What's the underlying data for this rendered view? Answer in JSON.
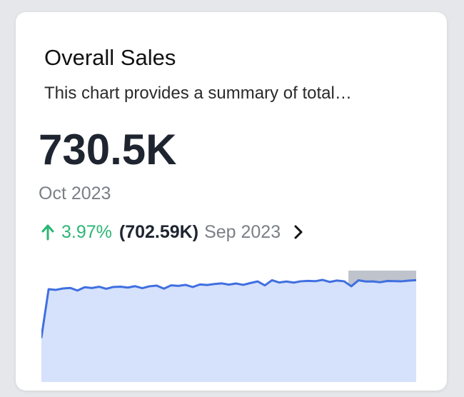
{
  "card": {
    "title": "Overall Sales",
    "description": "This chart provides a summary of total…",
    "kpi_value": "730.5K",
    "kpi_period": "Oct 2023",
    "change_percent": "3.97%",
    "previous_value": "(702.59K)",
    "previous_period": "Sep 2023",
    "change_direction": "up",
    "icons": {
      "trend": "arrow-up-icon",
      "navigate": "chevron-right-icon"
    }
  },
  "colors": {
    "positive": "#2bb673",
    "line": "#3f6fe0",
    "area_fill": "#d6e1fb",
    "highlight": "#b8bcc6"
  },
  "chart_data": {
    "type": "area",
    "ylim": [
      0,
      1000
    ],
    "values": [
      412,
      855,
      849,
      862,
      867,
      843,
      873,
      866,
      878,
      859,
      876,
      878,
      870,
      883,
      865,
      882,
      888,
      860,
      891,
      886,
      895,
      875,
      899,
      894,
      903,
      909,
      897,
      908,
      895,
      912,
      927,
      890,
      938,
      917,
      926,
      916,
      928,
      932,
      929,
      941,
      922,
      935,
      928,
      882,
      937,
      926,
      927,
      919,
      931,
      929,
      928,
      934,
      938
    ],
    "highlighted_range": [
      43,
      52
    ]
  }
}
